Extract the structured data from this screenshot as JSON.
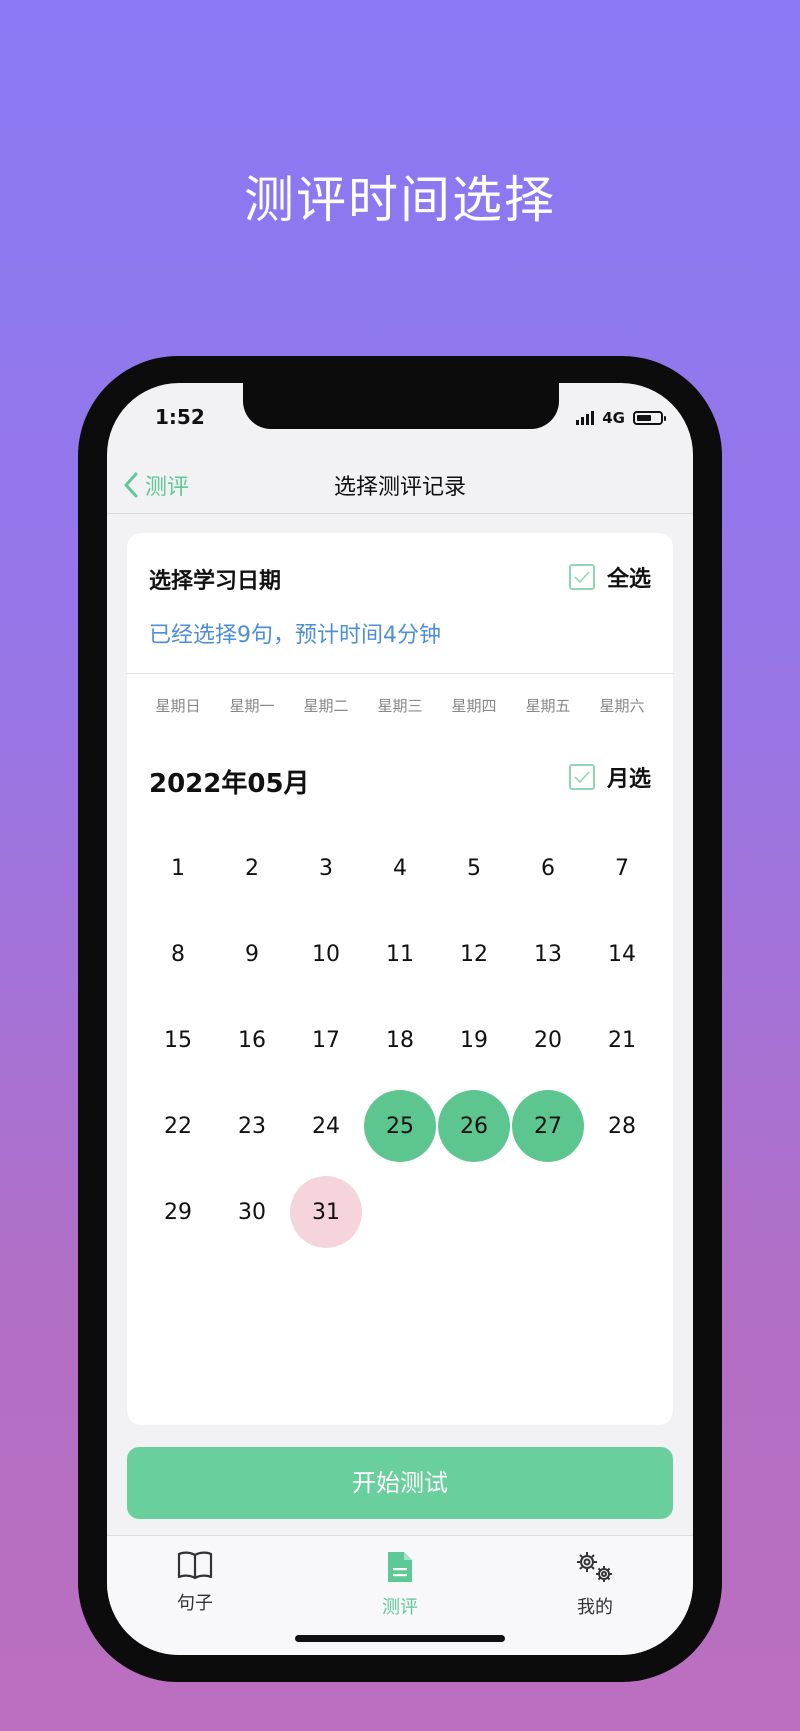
{
  "promo": {
    "title": "测评时间选择"
  },
  "status_bar": {
    "time": "1:52",
    "network": "4G"
  },
  "nav": {
    "back_label": "测评",
    "title": "选择测评记录"
  },
  "card": {
    "title": "选择学习日期",
    "select_all_label": "全选",
    "summary": "已经选择9句，预计时间4分钟",
    "weekdays": [
      "星期日",
      "星期一",
      "星期二",
      "星期三",
      "星期四",
      "星期五",
      "星期六"
    ],
    "month_title": "2022年05月",
    "month_select_label": "月选",
    "days": [
      "1",
      "2",
      "3",
      "4",
      "5",
      "6",
      "7",
      "8",
      "9",
      "10",
      "11",
      "12",
      "13",
      "14",
      "15",
      "16",
      "17",
      "18",
      "19",
      "20",
      "21",
      "22",
      "23",
      "24",
      "25",
      "26",
      "27",
      "28",
      "29",
      "30",
      "31"
    ],
    "selected_days": [
      "25",
      "26",
      "27"
    ],
    "highlighted_day": "31"
  },
  "start_button": {
    "label": "开始测试"
  },
  "tabs": [
    {
      "label": "句子",
      "icon": "book-icon"
    },
    {
      "label": "测评",
      "icon": "document-icon"
    },
    {
      "label": "我的",
      "icon": "gears-icon"
    }
  ],
  "colors": {
    "accent_green": "#5dc690",
    "selected_green": "#5dc690",
    "today_pink": "#f5d4dc",
    "link_blue": "#4c8fd8"
  }
}
